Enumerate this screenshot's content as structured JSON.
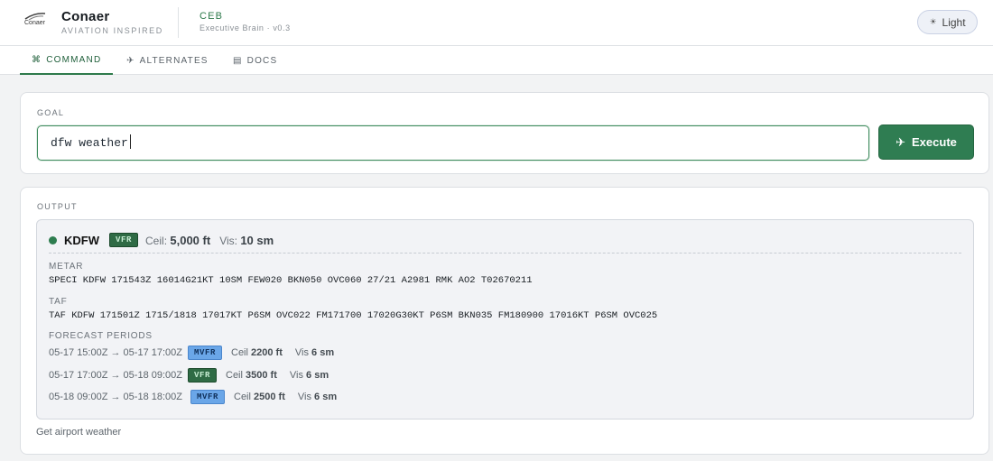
{
  "header": {
    "logo_text": "Conaer",
    "brand_name": "Conaer",
    "brand_tagline": "AVIATION INSPIRED",
    "app_code": "CEB",
    "app_subtitle": "Executive Brain · v0.3",
    "theme_toggle_label": "Light"
  },
  "tabs": [
    {
      "icon": "⌘",
      "label": "COMMAND",
      "active": true
    },
    {
      "icon": "✈",
      "label": "ALTERNATES",
      "active": false
    },
    {
      "icon": "▤",
      "label": "DOCS",
      "active": false
    }
  ],
  "goal": {
    "section_label": "GOAL",
    "input_value": "dfw weather",
    "execute_label": "Execute"
  },
  "output": {
    "section_label": "OUTPUT",
    "station": "KDFW",
    "category": "VFR",
    "ceiling_label": "Ceil:",
    "ceiling_value": "5,000 ft",
    "visibility_label": "Vis:",
    "visibility_value": "10 sm",
    "metar_label": "METAR",
    "metar": "SPECI KDFW 171543Z 16014G21KT 10SM FEW020 BKN050 OVC060 27/21 A2981 RMK AO2 T02670211",
    "taf_label": "TAF",
    "taf": "TAF KDFW 171501Z 1715/1818 17017KT P6SM OVC022 FM171700 17020G30KT P6SM BKN035 FM180900 17016KT P6SM OVC025",
    "forecast_label": "FORECAST PERIODS",
    "periods": [
      {
        "range": "05-17 15:00Z → 05-17 17:00Z",
        "category": "MVFR",
        "ceil_label": "Ceil",
        "ceil": "2200 ft",
        "vis_label": "Vis",
        "vis": "6 sm"
      },
      {
        "range": "05-17 17:00Z → 05-18 09:00Z",
        "category": "VFR",
        "ceil_label": "Ceil",
        "ceil": "3500 ft",
        "vis_label": "Vis",
        "vis": "6 sm"
      },
      {
        "range": "05-18 09:00Z → 05-18 18:00Z",
        "category": "MVFR",
        "ceil_label": "Ceil",
        "ceil": "2500 ft",
        "vis_label": "Vis",
        "vis": "6 sm"
      }
    ],
    "description": "Get airport weather"
  },
  "colors": {
    "accent_green": "#2f7d52",
    "vfr_badge": "#2f6b45",
    "mvfr_badge": "#6aa6e8"
  }
}
